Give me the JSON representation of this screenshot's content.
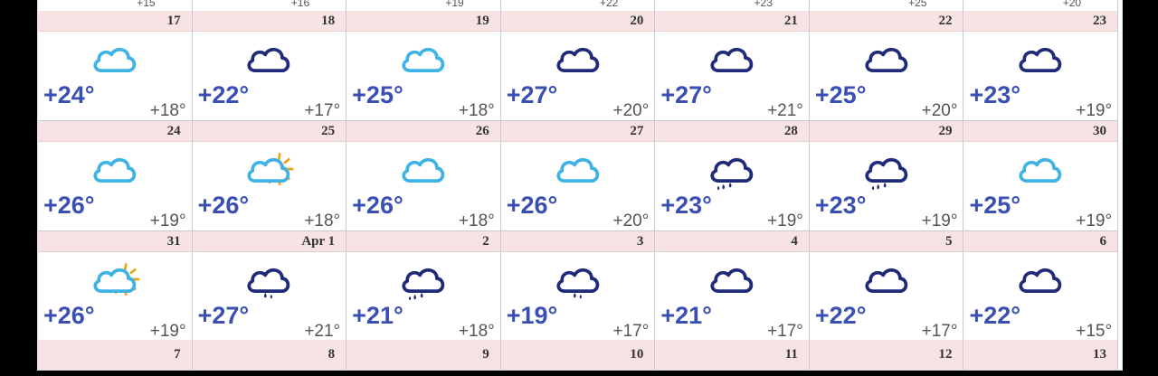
{
  "top_partial": [
    "+15",
    "+16",
    "+19",
    "+22",
    "+23",
    "+25",
    "+20"
  ],
  "weeks": [
    [
      {
        "date": "17",
        "icon": "cloud-light-icon",
        "hi": "+24°",
        "lo": "+18°"
      },
      {
        "date": "18",
        "icon": "cloud-dark-icon",
        "hi": "+22°",
        "lo": "+17°"
      },
      {
        "date": "19",
        "icon": "cloud-light-icon",
        "hi": "+25°",
        "lo": "+18°"
      },
      {
        "date": "20",
        "icon": "cloud-dark-icon",
        "hi": "+27°",
        "lo": "+20°"
      },
      {
        "date": "21",
        "icon": "cloud-dark-icon",
        "hi": "+27°",
        "lo": "+21°"
      },
      {
        "date": "22",
        "icon": "cloud-dark-icon",
        "hi": "+25°",
        "lo": "+20°"
      },
      {
        "date": "23",
        "icon": "cloud-dark-icon",
        "hi": "+23°",
        "lo": "+19°"
      }
    ],
    [
      {
        "date": "24",
        "icon": "cloud-light-icon",
        "hi": "+26°",
        "lo": "+19°"
      },
      {
        "date": "25",
        "icon": "sun-cloud-icon",
        "hi": "+26°",
        "lo": "+18°"
      },
      {
        "date": "26",
        "icon": "cloud-light-icon",
        "hi": "+26°",
        "lo": "+18°"
      },
      {
        "date": "27",
        "icon": "cloud-light-icon",
        "hi": "+26°",
        "lo": "+20°"
      },
      {
        "date": "28",
        "icon": "rain-cloud-icon",
        "hi": "+23°",
        "lo": "+19°"
      },
      {
        "date": "29",
        "icon": "rain-cloud-icon",
        "hi": "+23°",
        "lo": "+19°"
      },
      {
        "date": "30",
        "icon": "cloud-light-icon",
        "hi": "+25°",
        "lo": "+19°"
      }
    ],
    [
      {
        "date": "31",
        "icon": "sun-cloud-icon",
        "hi": "+26°",
        "lo": "+19°"
      },
      {
        "date": "Apr 1",
        "icon": "light-rain-cloud-icon",
        "hi": "+27°",
        "lo": "+21°"
      },
      {
        "date": "2",
        "icon": "rain-cloud-icon",
        "hi": "+21°",
        "lo": "+18°"
      },
      {
        "date": "3",
        "icon": "light-rain-cloud-icon",
        "hi": "+19°",
        "lo": "+17°"
      },
      {
        "date": "4",
        "icon": "cloud-dark-icon",
        "hi": "+21°",
        "lo": "+17°"
      },
      {
        "date": "5",
        "icon": "cloud-dark-icon",
        "hi": "+22°",
        "lo": "+17°"
      },
      {
        "date": "6",
        "icon": "cloud-dark-icon",
        "hi": "+22°",
        "lo": "+15°"
      }
    ]
  ],
  "last_row_dates": [
    "7",
    "8",
    "9",
    "10",
    "11",
    "12",
    "13"
  ],
  "colors": {
    "cloud_light": "#3fb3e4",
    "cloud_dark": "#1f2a78",
    "sun": "#f2a514",
    "temp_hi": "#3a4fb3",
    "header_bg": "#f7e3e3"
  }
}
